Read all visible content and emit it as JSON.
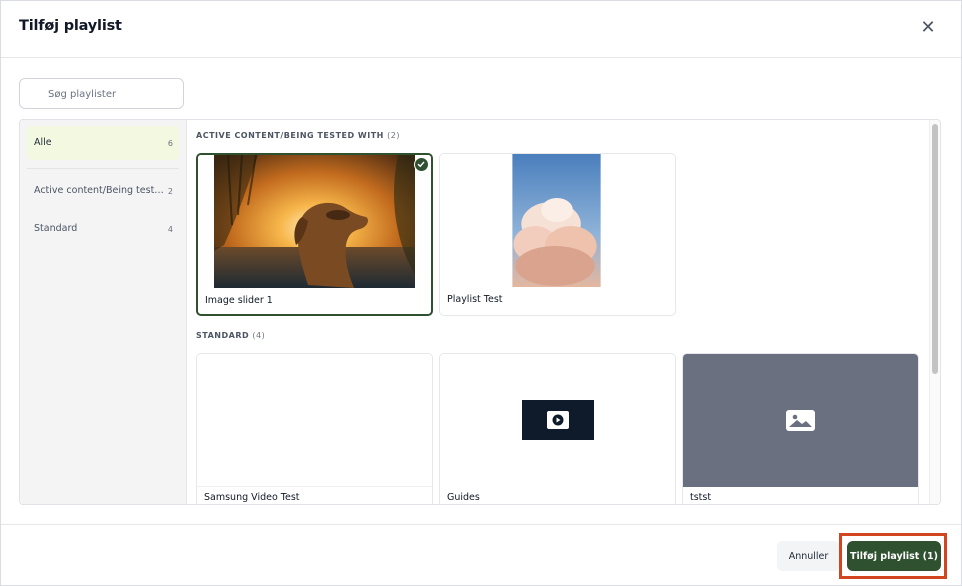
{
  "modal": {
    "title": "Tilføj playlist",
    "close_glyph": "✕"
  },
  "search": {
    "placeholder": "Søg playlister",
    "icon": "search-icon"
  },
  "sidebar": {
    "items": [
      {
        "label": "Alle",
        "count": "6",
        "active": true
      },
      {
        "label": "Active content/Being tested with",
        "count": "2",
        "active": false
      },
      {
        "label": "Standard",
        "count": "4",
        "active": false
      }
    ]
  },
  "sections": [
    {
      "title": "ACTIVE CONTENT/BEING TESTED WITH",
      "count": "(2)",
      "cards": [
        {
          "name": "Image slider 1",
          "selected": true,
          "thumb": "dog-sunset-photo"
        },
        {
          "name": "Playlist Test",
          "selected": false,
          "thumb": "clouds-photo"
        }
      ]
    },
    {
      "title": "STANDARD",
      "count": "(4)",
      "cards": [
        {
          "name": "Samsung Video Test",
          "selected": false,
          "thumb": "blank"
        },
        {
          "name": "Guides",
          "selected": false,
          "thumb": "video-icon"
        },
        {
          "name": "tstst",
          "selected": false,
          "thumb": "image-placeholder-icon"
        }
      ]
    }
  ],
  "footer": {
    "cancel_label": "Annuller",
    "submit_label": "Tilføj playlist (1)"
  },
  "colors": {
    "primary": "#2f5130",
    "active_bg": "#f3f8e1",
    "highlight": "#d2451e",
    "placeholder_bg": "#6b7280"
  }
}
